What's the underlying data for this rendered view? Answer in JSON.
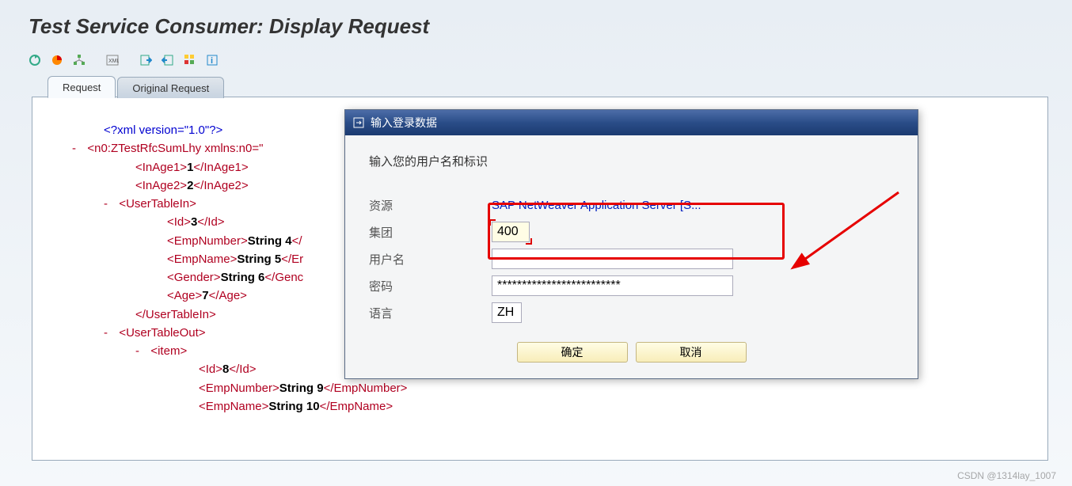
{
  "title": "Test Service Consumer: Display Request",
  "tabs": {
    "request": "Request",
    "original": "Original Request"
  },
  "xml": {
    "decl": "<?xml version=\"1.0\"?>",
    "root_open": "<n0:ZTestRfcSumLhy",
    "root_ns": " xmlns:n0=\"",
    "inage1_o": "<InAge1>",
    "inage1_v": "1",
    "inage1_c": "</InAge1>",
    "inage2_o": "<InAge2>",
    "inage2_v": "2",
    "inage2_c": "</InAge2>",
    "uti_o": "<UserTableIn>",
    "id_o": "<Id>",
    "id_v": "3",
    "id_c": "</Id>",
    "en_o": "<EmpNumber>",
    "en_v": "String 4",
    "en_c": "</",
    "em_o": "<EmpName>",
    "em_v": "String 5",
    "em_c": "</Er",
    "g_o": "<Gender>",
    "g_v": "String 6",
    "g_c": "</Genc",
    "a_o": "<Age>",
    "a_v": "7",
    "a_c": "</Age>",
    "uti_c": "</UserTableIn>",
    "uto_o": "<UserTableOut>",
    "item_o": "<item>",
    "id2_o": "<Id>",
    "id2_v": "8",
    "id2_c": "</Id>",
    "en2_o": "<EmpNumber>",
    "en2_v": "String 9",
    "en2_c": "</EmpNumber>",
    "em2_o": "<EmpName>",
    "em2_v": "String 10",
    "em2_c": "</EmpName>"
  },
  "dialog": {
    "title": "输入登录数据",
    "prompt": "输入您的用户名和标识",
    "labels": {
      "resource": "资源",
      "client": "集团",
      "user": "用户名",
      "password": "密码",
      "language": "语言"
    },
    "resource_value": "SAP NetWeaver Application Server [S...",
    "client_value": "400",
    "user_value": "",
    "password_value": "*************************",
    "language_value": "ZH",
    "ok": "确定",
    "cancel": "取消"
  },
  "watermark": "CSDN @1314lay_1007"
}
